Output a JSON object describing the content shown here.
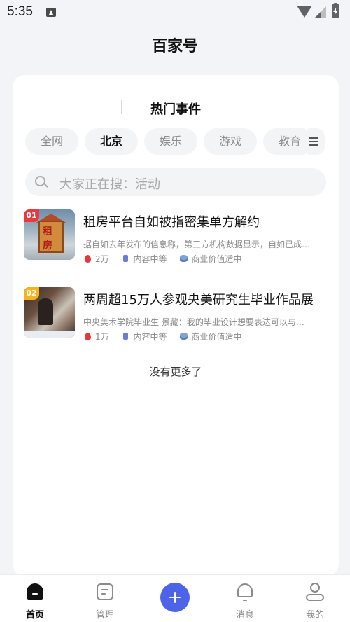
{
  "status_bar": {
    "time": "5:35"
  },
  "app_title": "百家号",
  "section_title": "热门事件",
  "tabs": [
    "全网",
    "北京",
    "娱乐",
    "游戏",
    "教育"
  ],
  "active_tab": "北京",
  "search": {
    "placeholder": "大家正在搜：活动"
  },
  "news": [
    {
      "rank": "01",
      "title": "租房平台自如被指密集单方解约",
      "desc": "据自如去年发布的信息称，第三方机构数据显示，自如已成…",
      "heat": "2万",
      "content_level": "内容中等",
      "commercial_value": "商业价值适中",
      "thumb_text": [
        "租",
        "房"
      ]
    },
    {
      "rank": "02",
      "title": "两周超15万人参观央美研究生毕业作品展",
      "desc": "中央美术学院毕业生 景藏：我的毕业设计想要表达可以与…",
      "heat": "1万",
      "content_level": "内容中等",
      "commercial_value": "商业价值适中"
    }
  ],
  "no_more": "没有更多了",
  "bottom_nav": {
    "home": "首页",
    "manage": "管理",
    "messages": "消息",
    "me": "我的"
  },
  "colors": {
    "accent": "#4d63e8",
    "rank1": "#e9383f",
    "rank2": "#f6b321",
    "heat": "#e23a3a"
  }
}
